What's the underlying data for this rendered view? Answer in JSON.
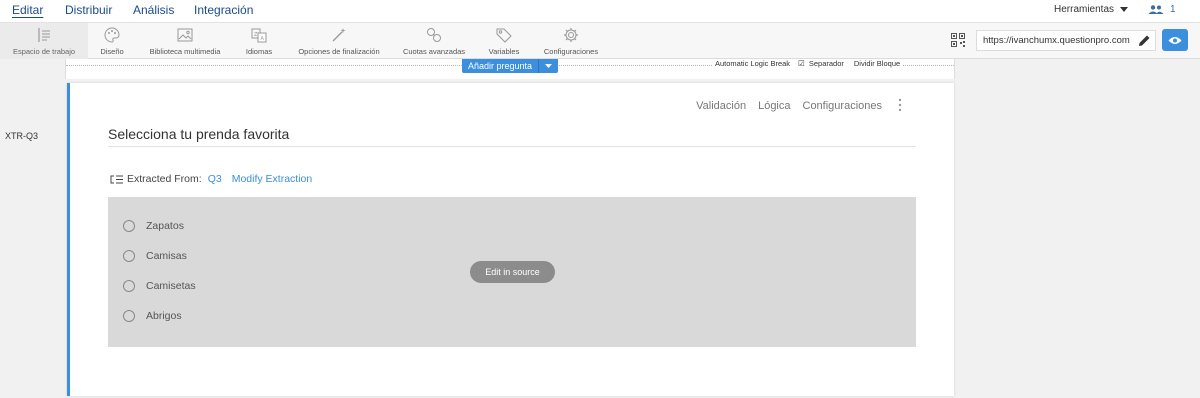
{
  "topnav": {
    "tabs": [
      "Editar",
      "Distribuir",
      "Análisis",
      "Integración"
    ],
    "tools_label": "Herramientas",
    "user_count": "1"
  },
  "toolbar": {
    "items": [
      {
        "label": "Espacio de trabajo",
        "icon": "workspace-icon"
      },
      {
        "label": "Diseño",
        "icon": "palette-icon"
      },
      {
        "label": "Biblioteca multimedia",
        "icon": "image-icon"
      },
      {
        "label": "Idiomas",
        "icon": "language-icon"
      },
      {
        "label": "Opciones de finalización",
        "icon": "magic-wand-icon"
      },
      {
        "label": "Cuotas avanzadas",
        "icon": "quota-icon"
      },
      {
        "label": "Variables",
        "icon": "tag-icon"
      },
      {
        "label": "Configuraciones",
        "icon": "gear-icon"
      }
    ],
    "survey_url": "https://ivanchumx.questionpro.com"
  },
  "canvas": {
    "add_question_label": "Añadir pregunta",
    "break_options": [
      "Automatic Logic Break",
      "Separador",
      "Dividir Bloque"
    ]
  },
  "question": {
    "row_id": "XTR-Q3",
    "actions": [
      "Validación",
      "Lógica",
      "Configuraciones"
    ],
    "title": "Selecciona tu prenda favorita",
    "extracted_from_label": "Extracted From:",
    "source_question": "Q3",
    "modify_label": "Modify Extraction",
    "options": [
      "Zapatos",
      "Camisas",
      "Camisetas",
      "Abrigos"
    ],
    "edit_source_label": "Edit in source"
  },
  "colors": {
    "accent": "#3b8fdc",
    "nav_text": "#1a4b8c",
    "options_bg": "#d9d9d9"
  }
}
